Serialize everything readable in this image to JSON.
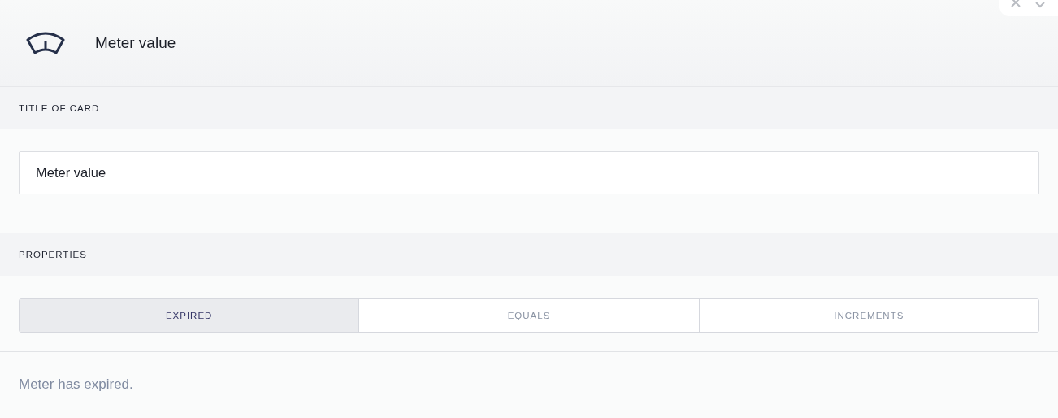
{
  "header": {
    "title": "Meter value"
  },
  "title_section": {
    "heading": "TITLE OF CARD",
    "value": "Meter value"
  },
  "properties": {
    "heading": "PROPERTIES",
    "tabs": [
      {
        "label": "EXPIRED",
        "selected": true
      },
      {
        "label": "EQUALS",
        "selected": false
      },
      {
        "label": "INCREMENTS",
        "selected": false
      }
    ],
    "description": "Meter has expired."
  }
}
